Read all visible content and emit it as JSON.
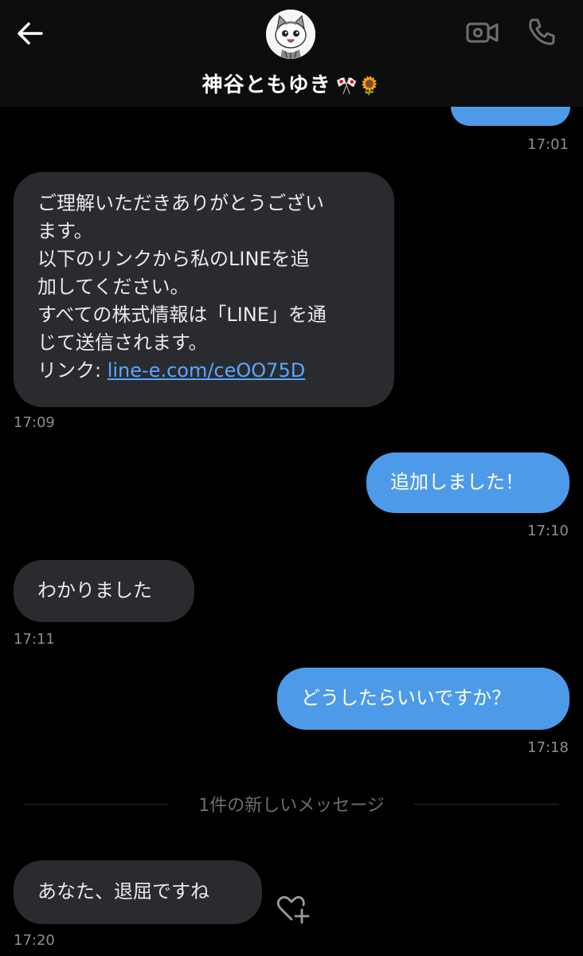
{
  "header": {
    "contact_name": "神谷ともゆき",
    "name_emoji": "🎌🌻"
  },
  "messages": [
    {
      "id": "m0",
      "direction": "outgoing",
      "time": "17:01"
    },
    {
      "id": "m1",
      "direction": "incoming",
      "lines": [
        "ご理解いただきありがとうござい",
        "ます。",
        "以下のリンクから私のLINEを追",
        "加してください。",
        "すべての株式情報は「LINE」を通",
        "じて送信されます。"
      ],
      "link_prefix": "リンク: ",
      "link_text": "line-e.com/ceOO75D",
      "time": "17:09"
    },
    {
      "id": "m2",
      "direction": "outgoing",
      "text": "追加しました！",
      "time": "17:10"
    },
    {
      "id": "m3",
      "direction": "incoming",
      "text": "わかりました",
      "time": "17:11"
    },
    {
      "id": "m4",
      "direction": "outgoing",
      "text": "どうしたらいいですか？",
      "time": "17:18"
    },
    {
      "id": "m5",
      "direction": "incoming",
      "text": "あなた、退屈ですね",
      "time": "17:20"
    }
  ],
  "divider": {
    "label": "1件の新しいメッセージ"
  },
  "icons": {
    "back": "back-arrow-icon",
    "video": "video-call-icon",
    "phone": "phone-icon",
    "react": "heart-plus-icon"
  },
  "colors": {
    "background": "#000000",
    "incoming_bubble": "#2a2b2f",
    "outgoing_bubble": "#4d9be8",
    "link": "#5aa6ff"
  }
}
